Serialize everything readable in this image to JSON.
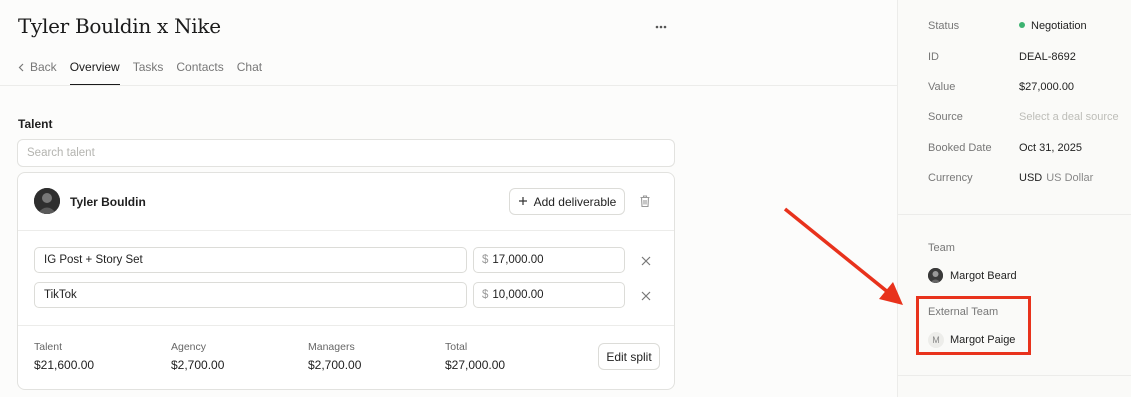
{
  "header": {
    "title": "Tyler Bouldin x Nike",
    "more_icon": "ellipsis-icon"
  },
  "tabs": {
    "back": "Back",
    "items": [
      "Overview",
      "Tasks",
      "Contacts",
      "Chat"
    ],
    "active": "Overview"
  },
  "talent_section": {
    "label": "Talent",
    "search_placeholder": "Search talent",
    "talent": {
      "name": "Tyler Bouldin",
      "add_deliverable_label": "Add deliverable",
      "deliverables": [
        {
          "name": "IG Post + Story Set",
          "currency_symbol": "$",
          "amount": "17,000.00"
        },
        {
          "name": "TikTok",
          "currency_symbol": "$",
          "amount": "10,000.00"
        }
      ],
      "split": [
        {
          "label": "Talent",
          "value": "$21,600.00"
        },
        {
          "label": "Agency",
          "value": "$2,700.00"
        },
        {
          "label": "Managers",
          "value": "$2,700.00"
        },
        {
          "label": "Total",
          "value": "$27,000.00"
        }
      ],
      "edit_split_label": "Edit split"
    }
  },
  "sidebar": {
    "properties": [
      {
        "label": "Status",
        "value": "Negotiation"
      },
      {
        "label": "ID",
        "value": "DEAL-8692"
      },
      {
        "label": "Value",
        "value": "$27,000.00"
      },
      {
        "label": "Source",
        "value": "Select a deal source"
      },
      {
        "label": "Booked Date",
        "value": "Oct 31, 2025"
      },
      {
        "label": "Currency",
        "value": "USD",
        "value_secondary": "US Dollar"
      }
    ],
    "status_color": "#3cb371",
    "team": {
      "heading": "Team",
      "members": [
        {
          "name": "Margot Beard"
        }
      ]
    },
    "external_team": {
      "heading": "External Team",
      "members": [
        {
          "initial": "M",
          "name": "Margot Paige"
        }
      ]
    }
  },
  "annotation": {
    "color": "#e8321c"
  }
}
